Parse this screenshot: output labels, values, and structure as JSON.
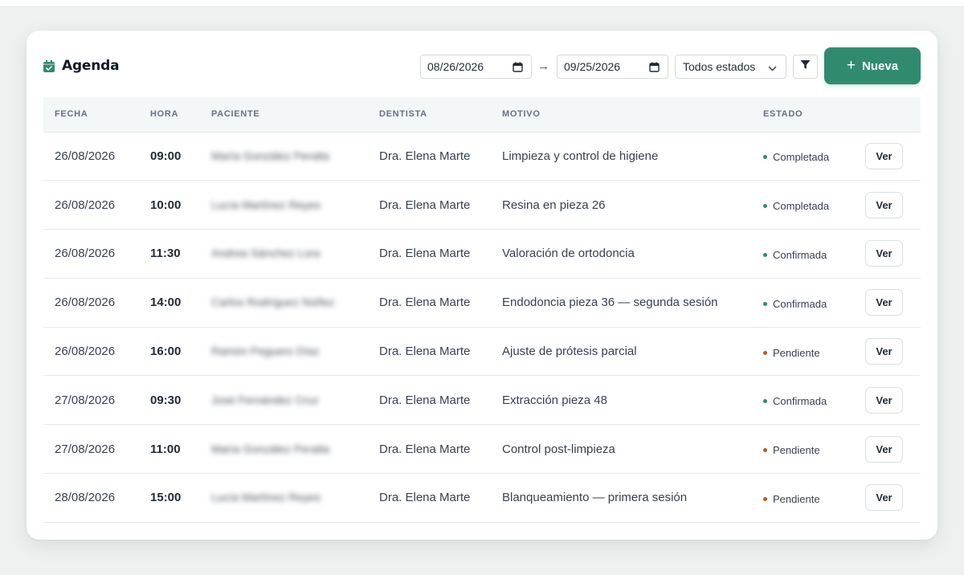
{
  "header": {
    "title": "Agenda",
    "date_from": "08/26/2026",
    "date_to": "09/25/2026",
    "arrow": "→",
    "status_filter": "Todos estados",
    "new_button": "Nueva",
    "accent_color": "#2f8a70"
  },
  "table": {
    "columns": [
      "FECHA",
      "HORA",
      "PACIENTE",
      "DENTISTA",
      "MOTIVO",
      "ESTADO"
    ],
    "action_label": "Ver",
    "rows": [
      {
        "fecha": "26/08/2026",
        "hora": "09:00",
        "paciente": "María González Peralta",
        "dentista": "Dra. Elena Marte",
        "motivo": "Limpieza y control de higiene",
        "estado": "Completada",
        "estado_color": "#2f8a70"
      },
      {
        "fecha": "26/08/2026",
        "hora": "10:00",
        "paciente": "Lucía Martínez Reyes",
        "dentista": "Dra. Elena Marte",
        "motivo": "Resina en pieza 26",
        "estado": "Completada",
        "estado_color": "#2f8a70"
      },
      {
        "fecha": "26/08/2026",
        "hora": "11:30",
        "paciente": "Andrea Sánchez Lora",
        "dentista": "Dra. Elena Marte",
        "motivo": "Valoración de ortodoncia",
        "estado": "Confirmada",
        "estado_color": "#2f8a70"
      },
      {
        "fecha": "26/08/2026",
        "hora": "14:00",
        "paciente": "Carlos Rodríguez Núñez",
        "dentista": "Dra. Elena Marte",
        "motivo": "Endodoncia pieza 36 — segunda sesión",
        "estado": "Confirmada",
        "estado_color": "#2f8a70"
      },
      {
        "fecha": "26/08/2026",
        "hora": "16:00",
        "paciente": "Ramón Peguero Díaz",
        "dentista": "Dra. Elena Marte",
        "motivo": "Ajuste de prótesis parcial",
        "estado": "Pendiente",
        "estado_color": "#c2571a"
      },
      {
        "fecha": "27/08/2026",
        "hora": "09:30",
        "paciente": "José Fernández Cruz",
        "dentista": "Dra. Elena Marte",
        "motivo": "Extracción pieza 48",
        "estado": "Confirmada",
        "estado_color": "#2f8a70"
      },
      {
        "fecha": "27/08/2026",
        "hora": "11:00",
        "paciente": "María González Peralta",
        "dentista": "Dra. Elena Marte",
        "motivo": "Control post-limpieza",
        "estado": "Pendiente",
        "estado_color": "#c2571a"
      },
      {
        "fecha": "28/08/2026",
        "hora": "15:00",
        "paciente": "Lucía Martínez Reyes",
        "dentista": "Dra. Elena Marte",
        "motivo": "Blanqueamiento — primera sesión",
        "estado": "Pendiente",
        "estado_color": "#c2571a"
      }
    ]
  }
}
